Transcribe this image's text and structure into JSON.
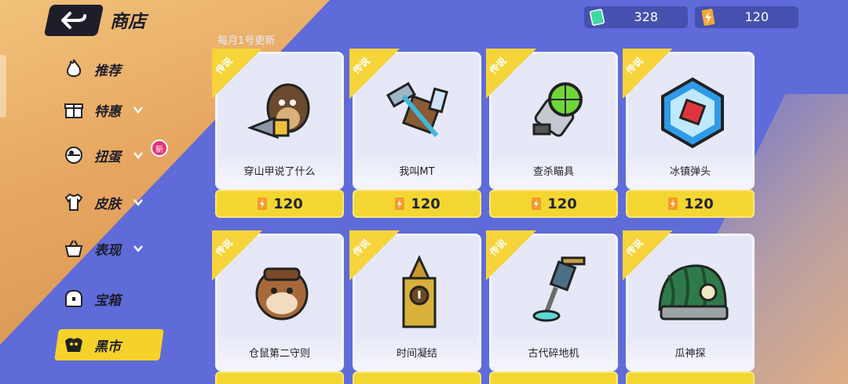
{
  "header": {
    "title": "商店",
    "back_icon": "back-arrow-icon"
  },
  "currencies": [
    {
      "icon": "ticket-icon",
      "value": "328",
      "color": "#3fd9a0"
    },
    {
      "icon": "gold-bolt-icon",
      "value": "120",
      "color": "#f4a83a"
    }
  ],
  "note": "每月1号更新",
  "sidebar": {
    "items": [
      {
        "label": "推荐",
        "icon": "flame-icon",
        "has_chevron": false
      },
      {
        "label": "特惠",
        "icon": "gift-icon",
        "has_chevron": true
      },
      {
        "label": "扭蛋",
        "icon": "capsule-icon",
        "has_chevron": true,
        "badge": "新"
      },
      {
        "label": "皮肤",
        "icon": "shirt-icon",
        "has_chevron": true
      },
      {
        "label": "表现",
        "icon": "basket-icon",
        "has_chevron": true
      },
      {
        "label": "宝箱",
        "icon": "chest-icon",
        "has_chevron": false
      },
      {
        "label": "黑市",
        "icon": "blackmarket-icon",
        "has_chevron": false,
        "active": true
      }
    ]
  },
  "cards": [
    {
      "rarity": "传说",
      "name": "穿山甲说了什么",
      "price": "120",
      "art": "mole-drill-icon"
    },
    {
      "rarity": "传说",
      "name": "我叫MT",
      "price": "120",
      "art": "hammer-icon"
    },
    {
      "rarity": "传说",
      "name": "查杀瞄具",
      "price": "120",
      "art": "scope-icon"
    },
    {
      "rarity": "传说",
      "name": "冰镇弹头",
      "price": "120",
      "art": "ice-cube-icon"
    },
    {
      "rarity": "传说",
      "name": "仓鼠第二守则",
      "price": "",
      "art": "hamster-icon"
    },
    {
      "rarity": "传说",
      "name": "时间凝结",
      "price": "",
      "art": "clock-tower-icon"
    },
    {
      "rarity": "传说",
      "name": "古代碎地机",
      "price": "",
      "art": "drill-machine-icon"
    },
    {
      "rarity": "传说",
      "name": "瓜神探",
      "price": "",
      "art": "melon-helmet-icon"
    }
  ],
  "colors": {
    "accent": "#f4d632",
    "background": "#5a66d6",
    "card": "#e6e8f8"
  }
}
